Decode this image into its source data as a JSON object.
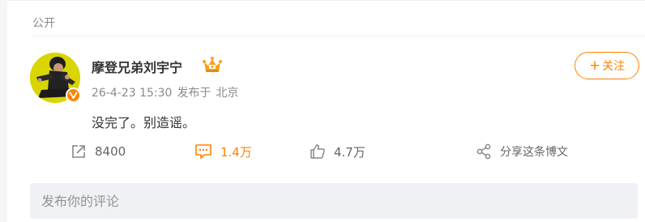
{
  "post": {
    "visibility": "公开",
    "author": {
      "name": "摩登兄弟刘宇宁",
      "verified": true,
      "verified_color": "#ff8200"
    },
    "time": "26-4-23 15:30",
    "source_label": "发布于",
    "location": "北京",
    "follow_label": "关注",
    "follow_plus": "+",
    "content": "没完了。别造谣。"
  },
  "actions": {
    "repost": {
      "icon": "repost-icon",
      "count": "8400"
    },
    "comment": {
      "icon": "comment-icon",
      "count": "1.4万",
      "active": true
    },
    "like": {
      "icon": "like-icon",
      "count": "4.7万"
    },
    "share": {
      "icon": "share-icon",
      "label": "分享这条博文"
    }
  },
  "comment_box": {
    "placeholder": "发布你的评论"
  },
  "colors": {
    "accent": "#ff8200",
    "text": "#333333",
    "muted": "#8a8a8a"
  }
}
